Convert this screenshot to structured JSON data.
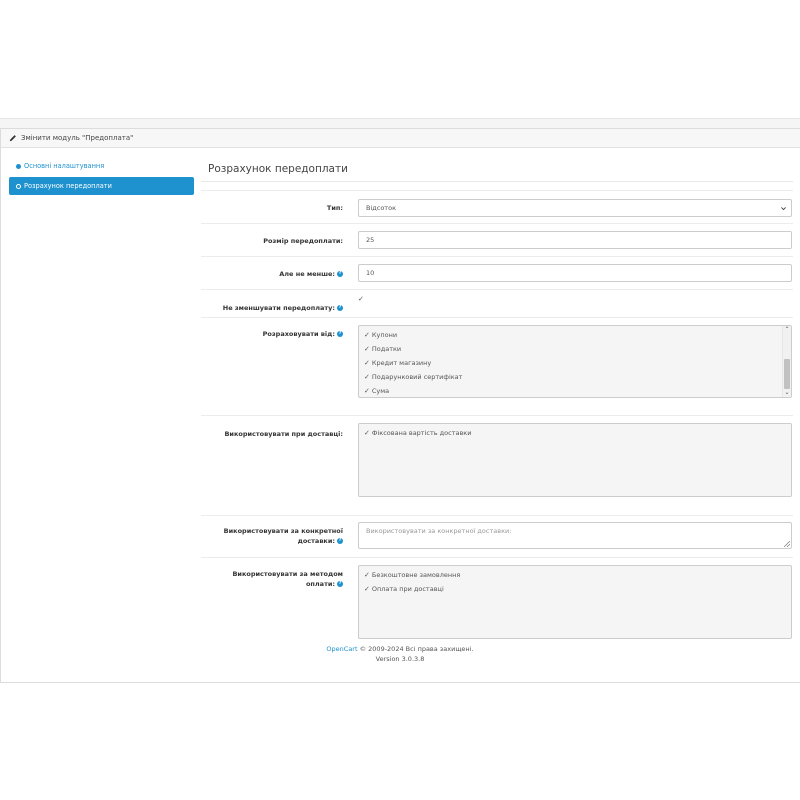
{
  "header": {
    "title": "Змінити модуль \"Предоплата\""
  },
  "sidebar": {
    "items": [
      {
        "label": "Основні налаштування",
        "active": false
      },
      {
        "label": "Розрахунок передоплати",
        "active": true
      }
    ]
  },
  "section": {
    "title": "Розрахунок передоплати"
  },
  "form": {
    "type": {
      "label": "Тип:",
      "value": "Відсоток"
    },
    "amount": {
      "label": "Розмір передоплати:",
      "value": "25"
    },
    "minimum": {
      "label": "Але не менше:",
      "value": "10"
    },
    "no_decrease": {
      "label": "Не зменшувати передоплату:",
      "checked": true
    },
    "calculate_from": {
      "label": "Розраховувати від:",
      "items": [
        {
          "label": "Купони",
          "checked": true
        },
        {
          "label": "Податки",
          "checked": true
        },
        {
          "label": "Кредит магазину",
          "checked": true
        },
        {
          "label": "Подарунковий сертифікат",
          "checked": true
        },
        {
          "label": "Сума",
          "checked": true
        }
      ]
    },
    "use_on_shipping": {
      "label": "Використовувати при доставці:",
      "items": [
        {
          "label": "Фіксована вартість доставки",
          "checked": true
        }
      ]
    },
    "use_specific_shipping": {
      "label_line1": "Використовувати за конкретної",
      "label_line2": "доставки:",
      "placeholder": "Використовувати за конкретної доставки:"
    },
    "use_payment_method": {
      "label_line1": "Використовувати за методом",
      "label_line2": "оплати:",
      "items": [
        {
          "label": "Безкоштовне замовлення",
          "checked": true
        },
        {
          "label": "Оплата при доставці",
          "checked": true
        }
      ]
    }
  },
  "footer": {
    "link": "OpenCart",
    "copyright": " © 2009-2024 Всі права захищені.",
    "version": "Version 3.0.3.8"
  },
  "help_icon": "?",
  "check_glyph": "✓",
  "colors": {
    "accent": "#1e91cf"
  }
}
